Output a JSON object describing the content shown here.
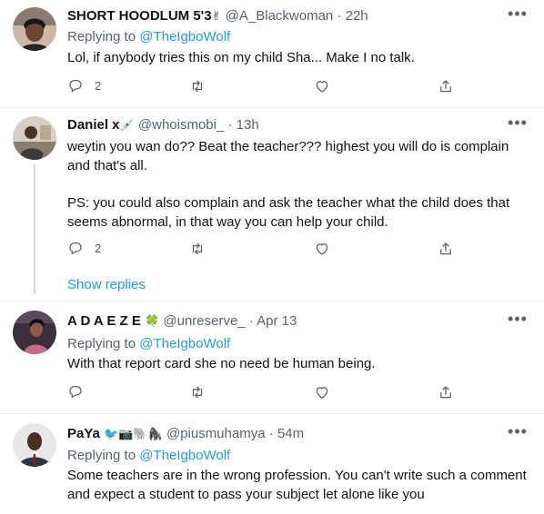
{
  "tweets": [
    {
      "name": "SHORT HOODLUM 5'3",
      "name_emoji": "✌",
      "handle": "@A_Blackwoman",
      "time": "22h",
      "replying_label": "Replying to",
      "replying_to": "@TheIgboWolf",
      "text": [
        "Lol, if anybody tries this on my child Sha... Make I no talk."
      ],
      "reply_count": "2"
    },
    {
      "name": "Daniel x",
      "name_emoji": "💉",
      "handle": "@whoismobi_",
      "time": "13h",
      "text": [
        "weytin you wan do?? Beat the teacher??? highest you will do is complain and that's all.",
        "PS: you could also complain and ask the teacher what the child does that seems abnormal, in that way you can help your child."
      ],
      "reply_count": "2",
      "show_replies": "Show replies"
    },
    {
      "name": "A D A E Z E",
      "name_emoji": "🍀",
      "handle": "@unreserve_",
      "time": "Apr 13",
      "replying_label": "Replying to",
      "replying_to": "@TheIgboWolf",
      "text": [
        "With that report card she no need be human being."
      ],
      "reply_count": ""
    },
    {
      "name": "PaYa",
      "name_emoji": "🐦📷🐘🦍",
      "handle": "@piusmuhamya",
      "time": "54m",
      "replying_label": "Replying to",
      "replying_to": "@TheIgboWolf",
      "text": [
        "Some teachers are in the wrong profession. You can't write such a comment and expect a student to pass your subject let alone like you"
      ],
      "reply_count": ""
    }
  ],
  "separator": "·",
  "more_glyph": "•••",
  "icons": [
    "reply-icon",
    "retweet-icon",
    "like-icon",
    "share-icon",
    "more-icon"
  ],
  "colors": {
    "link": "#1d9bf0",
    "secondary": "#536471",
    "divider": "#e6ecf0"
  }
}
